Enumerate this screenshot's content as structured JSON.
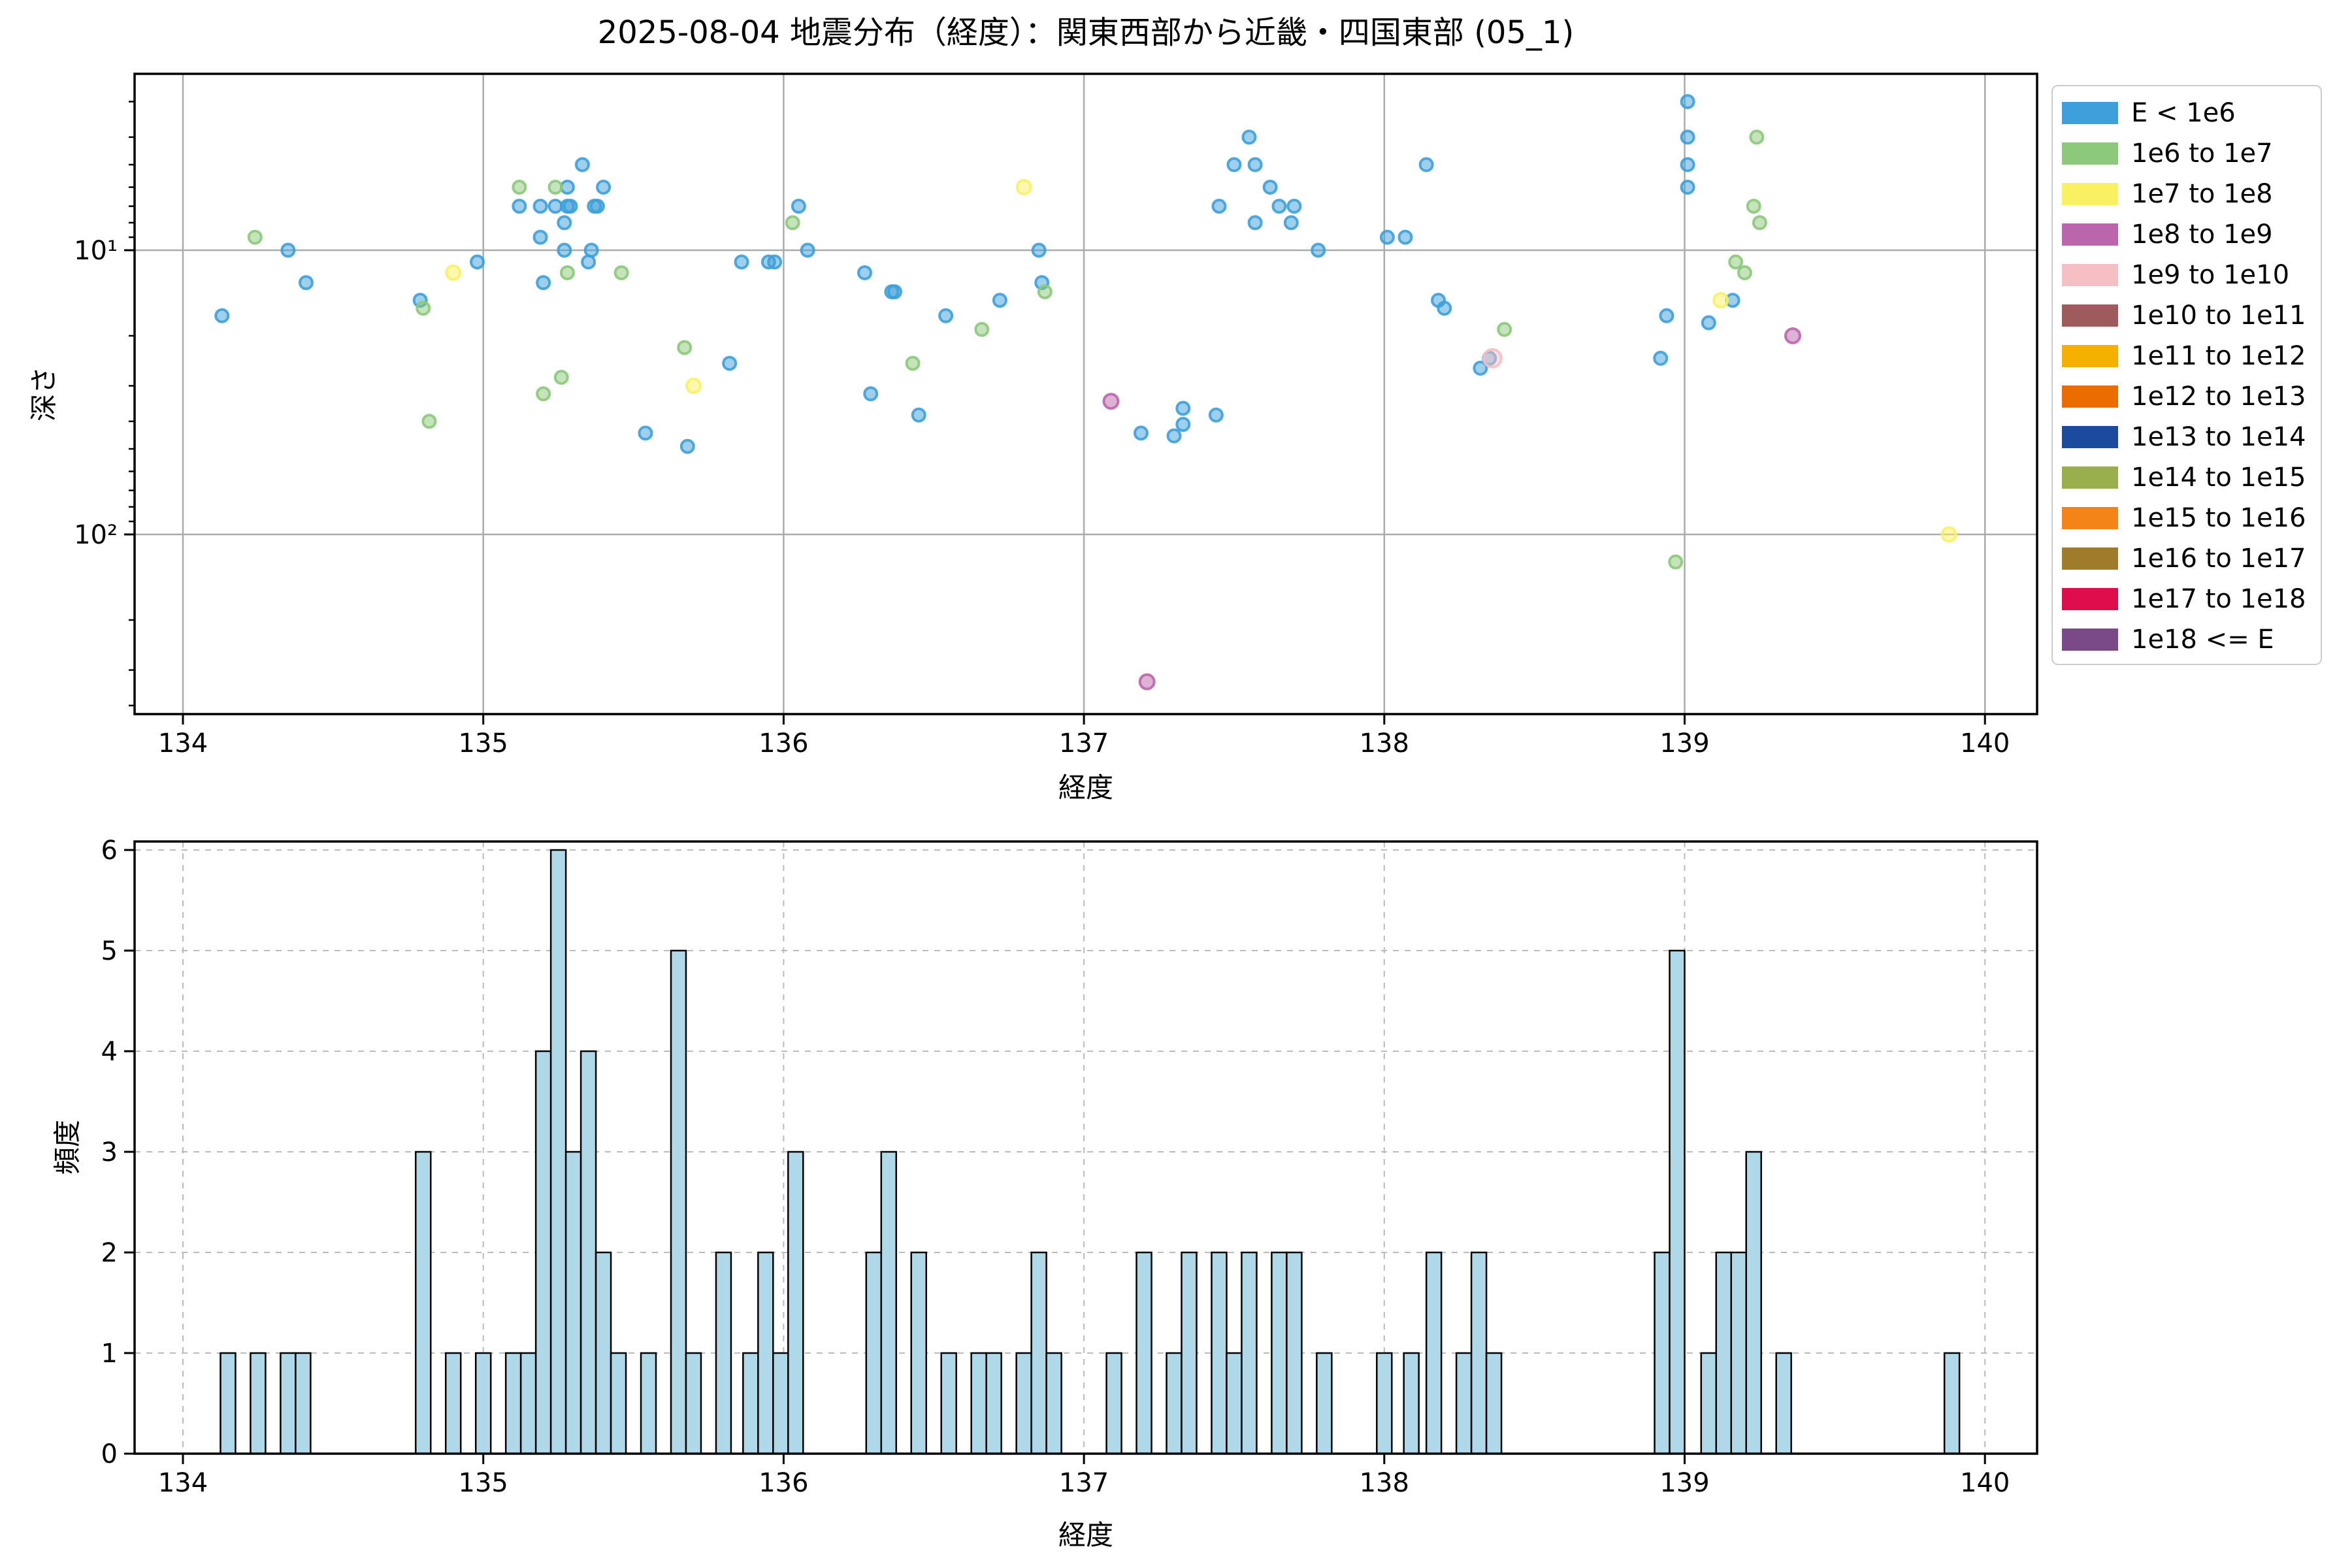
{
  "figure": {
    "title": "2025-08-04 地震分布（経度）：関東西部から近畿・四国東部 (05_1)",
    "background": "#ffffff"
  },
  "legend": {
    "entries": [
      {
        "label": "E < 1e6",
        "color": "#3DA0DA"
      },
      {
        "label": "1e6 to 1e7",
        "color": "#8CC97A"
      },
      {
        "label": "1e7 to 1e8",
        "color": "#FAF162"
      },
      {
        "label": "1e8 to 1e9",
        "color": "#BB65AC"
      },
      {
        "label": "1e9 to 1e10",
        "color": "#F5BFC4"
      },
      {
        "label": "1e10 to 1e11",
        "color": "#9E5A5D"
      },
      {
        "label": "1e11 to 1e12",
        "color": "#F5B000"
      },
      {
        "label": "1e12 to 1e13",
        "color": "#EB6D00"
      },
      {
        "label": "1e13 to 1e14",
        "color": "#1C4B9E"
      },
      {
        "label": "1e14 to 1e15",
        "color": "#99AF4E"
      },
      {
        "label": "1e15 to 1e16",
        "color": "#F58418"
      },
      {
        "label": "1e16 to 1e17",
        "color": "#9F7C2C"
      },
      {
        "label": "1e17 to 1e18",
        "color": "#DF0D4B"
      },
      {
        "label": "1e18 <= E",
        "color": "#7A4A86"
      }
    ]
  },
  "chart_data": [
    {
      "type": "scatter",
      "title": "2025-08-04 地震分布（経度）：関東西部から近畿・四国東部 (05_1)",
      "xlabel": "経度",
      "ylabel": "深さ",
      "xlim": [
        133.84,
        140.17
      ],
      "ylim": [
        430,
        2.4
      ],
      "y_scale": "log (inverted, depth km)",
      "grid": true,
      "x_ticks": [
        134,
        135,
        136,
        137,
        138,
        139,
        140
      ],
      "y_ticks": [
        {
          "value": 10,
          "label": "10¹"
        },
        {
          "value": 100,
          "label": "10²"
        }
      ],
      "y_minor_ticks": [
        3,
        4,
        5,
        6,
        7,
        8,
        9,
        20,
        30,
        40,
        50,
        60,
        70,
        80,
        90,
        200,
        300,
        400
      ],
      "legend_position": "outside upper right",
      "series": [
        {
          "name": "E < 1e6",
          "color": "#3DA0DA",
          "marker_radius": 9.5,
          "points": [
            [
              134.13,
              17
            ],
            [
              134.35,
              10
            ],
            [
              134.41,
              13
            ],
            [
              134.79,
              15
            ],
            [
              134.98,
              11
            ],
            [
              135.33,
              5
            ],
            [
              135.28,
              6
            ],
            [
              135.4,
              6
            ],
            [
              135.12,
              7
            ],
            [
              135.19,
              7
            ],
            [
              135.24,
              7
            ],
            [
              135.28,
              7
            ],
            [
              135.29,
              7
            ],
            [
              135.37,
              7
            ],
            [
              135.38,
              7
            ],
            [
              135.27,
              8
            ],
            [
              135.19,
              9
            ],
            [
              135.27,
              10
            ],
            [
              135.36,
              10
            ],
            [
              135.35,
              11
            ],
            [
              135.2,
              13
            ],
            [
              135.54,
              44
            ],
            [
              135.68,
              49
            ],
            [
              135.82,
              25
            ],
            [
              135.86,
              11
            ],
            [
              135.95,
              11
            ],
            [
              135.97,
              11
            ],
            [
              136.05,
              7
            ],
            [
              136.08,
              10
            ],
            [
              136.27,
              12
            ],
            [
              136.36,
              14
            ],
            [
              136.37,
              14
            ],
            [
              136.54,
              17
            ],
            [
              136.72,
              15
            ],
            [
              136.29,
              32
            ],
            [
              136.45,
              38
            ],
            [
              136.85,
              10
            ],
            [
              136.86,
              13
            ],
            [
              137.19,
              44
            ],
            [
              137.3,
              45
            ],
            [
              137.33,
              41
            ],
            [
              137.33,
              36
            ],
            [
              137.44,
              38
            ],
            [
              137.55,
              4
            ],
            [
              137.5,
              5
            ],
            [
              137.57,
              5
            ],
            [
              137.45,
              7
            ],
            [
              137.62,
              6
            ],
            [
              137.65,
              7
            ],
            [
              137.7,
              7
            ],
            [
              137.57,
              8
            ],
            [
              137.69,
              8
            ],
            [
              137.78,
              10
            ],
            [
              138.01,
              9
            ],
            [
              138.07,
              9
            ],
            [
              138.14,
              5
            ],
            [
              138.18,
              15
            ],
            [
              138.2,
              16
            ],
            [
              138.35,
              24
            ],
            [
              138.32,
              26
            ],
            [
              138.94,
              17
            ],
            [
              138.92,
              24
            ],
            [
              139.01,
              3
            ],
            [
              139.01,
              4
            ],
            [
              139.01,
              5
            ],
            [
              139.01,
              6
            ],
            [
              139.16,
              15
            ],
            [
              139.08,
              18
            ]
          ]
        },
        {
          "name": "1e6 to 1e7",
          "color": "#8CC97A",
          "marker_radius": 9.5,
          "points": [
            [
              134.24,
              9
            ],
            [
              134.8,
              16
            ],
            [
              134.82,
              40
            ],
            [
              135.12,
              6
            ],
            [
              135.24,
              6
            ],
            [
              135.28,
              12
            ],
            [
              135.46,
              12
            ],
            [
              135.26,
              28
            ],
            [
              135.2,
              32
            ],
            [
              135.67,
              22
            ],
            [
              136.03,
              8
            ],
            [
              136.43,
              25
            ],
            [
              136.66,
              19
            ],
            [
              136.87,
              14
            ],
            [
              138.4,
              19
            ],
            [
              138.97,
              125
            ],
            [
              139.24,
              4
            ],
            [
              139.23,
              7
            ],
            [
              139.25,
              8
            ],
            [
              139.17,
              11
            ],
            [
              139.2,
              12
            ]
          ]
        },
        {
          "name": "1e7 to 1e8",
          "color": "#FAF162",
          "marker_radius": 10.5,
          "points": [
            [
              134.9,
              12
            ],
            [
              135.7,
              30
            ],
            [
              136.8,
              6
            ],
            [
              139.12,
              15
            ],
            [
              139.88,
              100
            ]
          ]
        },
        {
          "name": "1e8 to 1e9",
          "color": "#BB65AC",
          "marker_radius": 11,
          "points": [
            [
              137.09,
              34
            ],
            [
              137.21,
              330
            ],
            [
              139.36,
              20
            ]
          ]
        },
        {
          "name": "1e9 to 1e10",
          "color": "#F5BFC4",
          "marker_radius": 13.5,
          "points": [
            [
              138.36,
              24
            ]
          ]
        }
      ]
    },
    {
      "type": "bar",
      "xlabel": "経度",
      "ylabel": "頻度",
      "xlim": [
        133.84,
        140.17
      ],
      "ylim": [
        0,
        6.1
      ],
      "grid": "dashed",
      "x_ticks": [
        134,
        135,
        136,
        137,
        138,
        139,
        140
      ],
      "y_ticks": [
        0,
        1,
        2,
        3,
        4,
        5,
        6
      ],
      "bin_width": 0.05,
      "bar_color": "#AFD8E8",
      "bar_edge_color": "#000000",
      "bars": [
        [
          134.125,
          1
        ],
        [
          134.225,
          1
        ],
        [
          134.325,
          1
        ],
        [
          134.375,
          1
        ],
        [
          134.775,
          3
        ],
        [
          134.875,
          1
        ],
        [
          134.975,
          1
        ],
        [
          135.075,
          1
        ],
        [
          135.125,
          1
        ],
        [
          135.175,
          4
        ],
        [
          135.225,
          6
        ],
        [
          135.275,
          3
        ],
        [
          135.325,
          4
        ],
        [
          135.375,
          2
        ],
        [
          135.425,
          1
        ],
        [
          135.525,
          1
        ],
        [
          135.625,
          5
        ],
        [
          135.675,
          1
        ],
        [
          135.775,
          2
        ],
        [
          135.865,
          1
        ],
        [
          135.915,
          2
        ],
        [
          135.965,
          1
        ],
        [
          136.015,
          3
        ],
        [
          136.275,
          2
        ],
        [
          136.325,
          3
        ],
        [
          136.425,
          2
        ],
        [
          136.525,
          1
        ],
        [
          136.625,
          1
        ],
        [
          136.675,
          1
        ],
        [
          136.775,
          1
        ],
        [
          136.825,
          2
        ],
        [
          136.875,
          1
        ],
        [
          137.075,
          1
        ],
        [
          137.175,
          2
        ],
        [
          137.275,
          1
        ],
        [
          137.325,
          2
        ],
        [
          137.425,
          2
        ],
        [
          137.475,
          1
        ],
        [
          137.525,
          2
        ],
        [
          137.625,
          2
        ],
        [
          137.675,
          2
        ],
        [
          137.775,
          1
        ],
        [
          137.975,
          1
        ],
        [
          138.065,
          1
        ],
        [
          138.14,
          2
        ],
        [
          138.24,
          1
        ],
        [
          138.29,
          2
        ],
        [
          138.34,
          1
        ],
        [
          138.9,
          2
        ],
        [
          138.95,
          5
        ],
        [
          139.055,
          1
        ],
        [
          139.105,
          2
        ],
        [
          139.155,
          2
        ],
        [
          139.205,
          3
        ],
        [
          139.305,
          1
        ],
        [
          139.865,
          1
        ]
      ]
    }
  ]
}
